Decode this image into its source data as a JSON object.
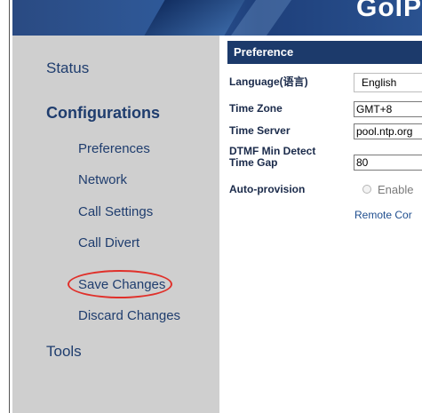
{
  "banner": {
    "logo_text": "GoIP"
  },
  "sidebar": {
    "status": "Status",
    "configurations": "Configurations",
    "items": [
      {
        "label": "Preferences"
      },
      {
        "label": "Network"
      },
      {
        "label": "Call Settings"
      },
      {
        "label": "Call Divert"
      },
      {
        "label": "Save Changes"
      },
      {
        "label": "Discard Changes"
      }
    ],
    "tools": "Tools"
  },
  "main": {
    "section_title": "Preference",
    "fields": {
      "language": {
        "label": "Language(语言)",
        "value": "English"
      },
      "time_zone": {
        "label": "Time Zone",
        "value": "GMT+8"
      },
      "time_server": {
        "label": "Time Server",
        "value": "pool.ntp.org"
      },
      "dtmf": {
        "label": "DTMF Min Detect Time Gap",
        "value": "80"
      },
      "auto_provision": {
        "label": "Auto-provision",
        "option": "Enable"
      }
    },
    "remote_link": "Remote Cor"
  },
  "colors": {
    "banner": "#2a4a82",
    "sidebar": "#cfcfcf",
    "nav_text": "#1f3d6e",
    "section_header": "#1c3a6b",
    "highlight_circle": "#e0302a"
  }
}
